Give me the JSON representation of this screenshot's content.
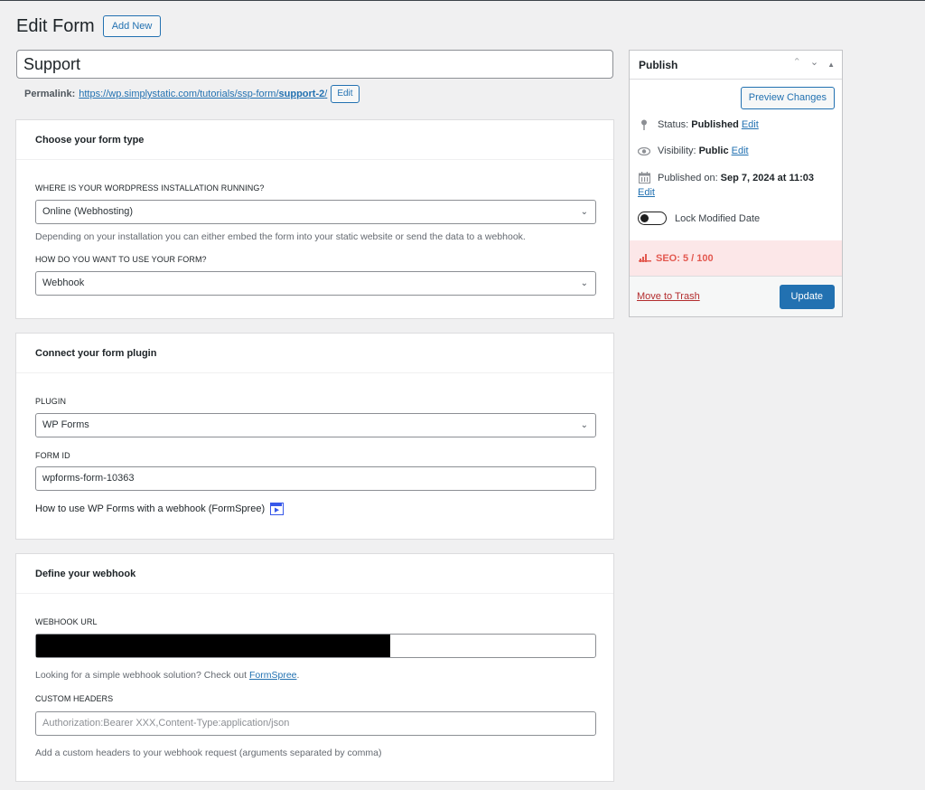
{
  "header": {
    "title": "Edit Form",
    "add_new_label": "Add New"
  },
  "title_field": {
    "value": "Support"
  },
  "permalink": {
    "label": "Permalink:",
    "url_base": "https://wp.simplystatic.com/tutorials/ssp-form/",
    "slug": "support-2",
    "url_trailing": "/",
    "edit_label": "Edit"
  },
  "form_type_box": {
    "title": "Choose your form type",
    "installation_label": "WHERE IS YOUR WORDPRESS INSTALLATION RUNNING?",
    "installation_value": "Online (Webhosting)",
    "installation_help": "Depending on your installation you can either embed the form into your static website or send the data to a webhook.",
    "usage_label": "HOW DO YOU WANT TO USE YOUR FORM?",
    "usage_value": "Webhook"
  },
  "plugin_box": {
    "title": "Connect your form plugin",
    "plugin_label": "PLUGIN",
    "plugin_value": "WP Forms",
    "form_id_label": "FORM ID",
    "form_id_value": "wpforms-form-10363",
    "help_text": "How to use WP Forms with a webhook (FormSpree)",
    "video_icon": "video-play-icon"
  },
  "webhook_box": {
    "title": "Define your webhook",
    "url_label": "WEBHOOK URL",
    "url_value": "[redacted]",
    "url_help_prefix": "Looking for a simple webhook solution? Check out ",
    "url_help_link": "FormSpree",
    "url_help_suffix": ".",
    "headers_label": "CUSTOM HEADERS",
    "headers_placeholder": "Authorization:Bearer XXX,Content-Type:application/json",
    "headers_help": "Add a custom headers to your webhook request (arguments separated by comma)"
  },
  "publish": {
    "title": "Publish",
    "preview_label": "Preview Changes",
    "status_label": "Status:",
    "status_value": "Published",
    "visibility_label": "Visibility:",
    "visibility_value": "Public",
    "published_label": "Published on:",
    "published_value": "Sep 7, 2024 at 11:03",
    "edit_label": "Edit",
    "lock_label": "Lock Modified Date",
    "lock_enabled": false,
    "seo_label": "SEO: 5 / 100",
    "seo_color": "#e35950",
    "trash_label": "Move to Trash",
    "update_label": "Update"
  },
  "colors": {
    "accent": "#2271b1",
    "background": "#f0f0f1",
    "danger": "#b32d2e",
    "seo_bg": "#fce7e8"
  }
}
